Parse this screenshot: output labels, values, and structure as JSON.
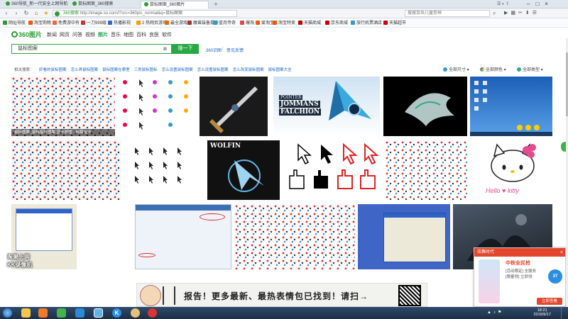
{
  "browser": {
    "tabs": [
      {
        "label": "360导航_新一代安全上网导航",
        "color": "#2d9b33"
      },
      {
        "label": "鼠标图案_360搜索",
        "color": "#2d9b33"
      },
      {
        "label": "鼠标图案_360图片",
        "color": "#2d9b33"
      }
    ],
    "new_tab": "+",
    "url": "http://image.so.com/i?src=360pic_normal&q=鼠标图案",
    "url_prefix": "360搜索",
    "search_placeholder": "搜搜百岳儿童受神",
    "nav": {
      "back": "‹",
      "forward": "›",
      "refresh": "↻",
      "home": "⌂"
    },
    "window_controls": {
      "min": "–",
      "max": "□",
      "close": "×"
    }
  },
  "favorites": [
    {
      "label": "网址导航",
      "color": "#2d9b33"
    },
    {
      "label": "淘宝购物",
      "color": "#f50"
    },
    {
      "label": "免费游中有",
      "color": "#e63"
    },
    {
      "label": "一刀999级",
      "color": "#c33"
    },
    {
      "label": "热播影视",
      "color": "#36c"
    },
    {
      "label": "2 热网页游戏",
      "color": "#f90"
    },
    {
      "label": "最全游戏",
      "color": "#e60"
    },
    {
      "label": "魔兽装备提升",
      "color": "#a33"
    },
    {
      "label": "蓝月传奇",
      "color": "#39c"
    },
    {
      "label": "爆淘",
      "color": "#e44"
    },
    {
      "label": "爱淘宝",
      "color": "#f50"
    },
    {
      "label": "淘宝特卖",
      "color": "#f50"
    },
    {
      "label": "天猫商城",
      "color": "#c00"
    },
    {
      "label": "京东商城",
      "color": "#c00"
    },
    {
      "label": "旅行机票酒店",
      "color": "#39c"
    },
    {
      "label": "天猫超市",
      "color": "#c00"
    }
  ],
  "site": {
    "logo": "360图片",
    "nav": [
      "新闻",
      "网页",
      "问答",
      "视频",
      "图片",
      "音乐",
      "地图",
      "百科",
      "良医",
      "软件"
    ],
    "active_nav": "图片",
    "query": "鼠标图案",
    "search_button": "搜一下",
    "links": [
      "360识图",
      "意见反馈"
    ]
  },
  "related": {
    "label": "相关搜索：",
    "items": [
      "好看的鼠标图案",
      "怎么弄鼠标图案",
      "鼠标图案在哪里",
      "三类鼠标图标",
      "怎么设置鼠标图案",
      "怎么设置鼠标图案",
      "怎么改变鼠标图案",
      "鼠标图案大全"
    ]
  },
  "filters": [
    "全部尺寸",
    "全部颜色",
    "全部类型"
  ],
  "results": {
    "row1_caption": "鼠标图案_鼠标指针图案 显卡放图 - 网易宝卡",
    "captions": {
      "falchion_top": "POINTER",
      "falchion_mid": "JOMMANS",
      "falchion_bot": "FALCHION",
      "wolfin": "WOLFIN",
      "hello_kitty": "Hello ♥ kitty"
    }
  },
  "promo": {
    "header": "炫舞时代",
    "close": "×",
    "title": "中秋全民抢",
    "line1": "[活动限定] 全服务",
    "line2": "[限量领] 立即领",
    "cta": "立即查看"
  },
  "banner": {
    "text": "报告！更多最新、最热表情包已找到！请扫→"
  },
  "watermark": {
    "line1": "淘果上网",
    "line2": "KK录像机"
  },
  "taskbar": {
    "time": "18:21",
    "date": "2016/9/17",
    "apps": [
      "start-icon",
      "folder-icon",
      "media-icon",
      "qq-icon",
      "ie-icon",
      "chrome-icon",
      "kk-icon",
      "avatar-icon"
    ]
  },
  "colors": {
    "brand_green": "#28a745",
    "link_blue": "#1a66c6",
    "promo_red": "#e2462c"
  }
}
